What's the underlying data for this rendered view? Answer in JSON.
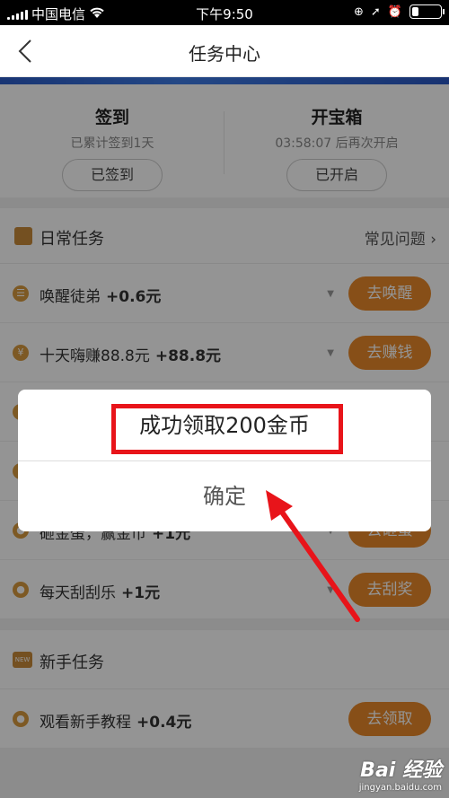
{
  "status_bar": {
    "carrier": "中国电信",
    "time": "下午9:50"
  },
  "nav": {
    "title": "任务中心"
  },
  "checkin": {
    "sign": {
      "title": "签到",
      "subtitle": "已累计签到1天",
      "button": "已签到"
    },
    "box": {
      "title": "开宝箱",
      "subtitle": "03:58:07 后再次开启",
      "button": "已开启"
    }
  },
  "daily": {
    "title": "日常任务",
    "faq": "常见问题 ›",
    "tasks": [
      {
        "name": "唤醒徒弟",
        "reward": "+0.6元",
        "button": "去唤醒",
        "icon": "☰"
      },
      {
        "name": "十天嗨赚88.8元",
        "reward": "+88.8元",
        "button": "去赚钱",
        "icon": "¥"
      },
      {
        "name": "",
        "reward": "",
        "button": "",
        "icon": ""
      },
      {
        "name": "",
        "reward": "",
        "button": "",
        "icon": ""
      },
      {
        "name": "砸金蛋，赢金币",
        "reward": "+1元",
        "button": "去砸蛋",
        "icon": "●"
      },
      {
        "name": "每天刮刮乐",
        "reward": "+1元",
        "button": "去刮奖",
        "icon": "●"
      }
    ]
  },
  "newbie": {
    "title": "新手任务",
    "icon_text": "NEW",
    "tasks": [
      {
        "name": "观看新手教程",
        "reward": "+0.4元",
        "button": "去领取",
        "icon": "●"
      }
    ]
  },
  "dialog": {
    "message": "成功领取200金币",
    "confirm": "确定"
  },
  "watermark": {
    "logo": "Bai 经验",
    "url": "jingyan.baidu.com"
  },
  "colors": {
    "accent": "#e8892a",
    "highlight": "#e8141a"
  }
}
